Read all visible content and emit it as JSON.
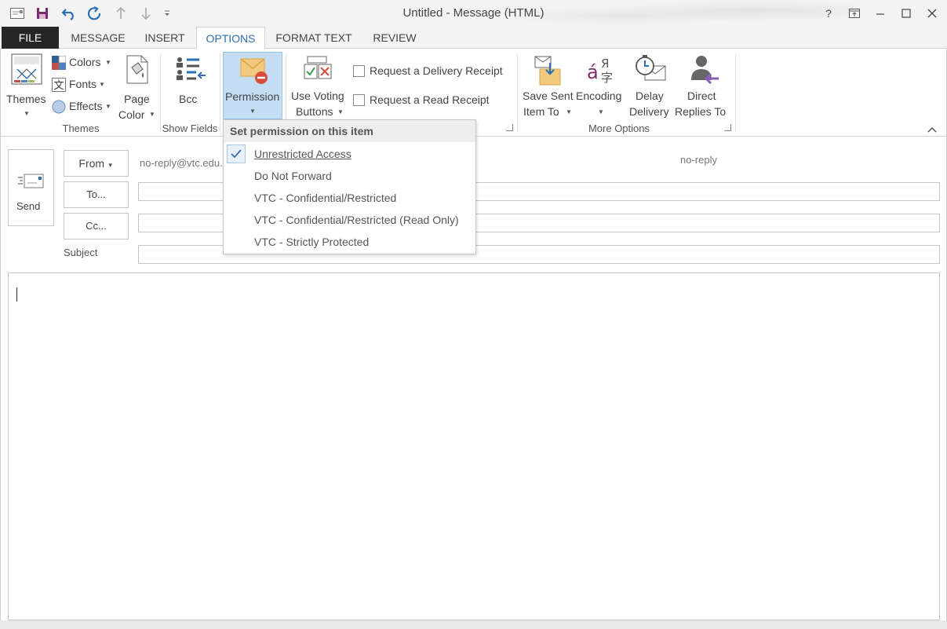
{
  "window": {
    "title": "Untitled - Message (HTML)",
    "help": "?"
  },
  "tabs": [
    "FILE",
    "MESSAGE",
    "INSERT",
    "OPTIONS",
    "FORMAT TEXT",
    "REVIEW"
  ],
  "ribbon": {
    "themes": {
      "themes_label": "Themes",
      "colors_label": "Colors",
      "fonts_label": "Fonts",
      "effects_label": "Effects",
      "page_label": "Page",
      "color_label": "Color",
      "group_label": "Themes"
    },
    "show_fields": {
      "bcc_label": "Bcc",
      "group_label": "Show Fields"
    },
    "permission": {
      "label": "Permission"
    },
    "tracking": {
      "voting_line1": "Use Voting",
      "voting_line2": "Buttons",
      "delivery_receipt": "Request a Delivery Receipt",
      "read_receipt": "Request a Read Receipt"
    },
    "more_options": {
      "save_line1": "Save Sent",
      "save_line2": "Item To",
      "encoding_label": "Encoding",
      "delay_line1": "Delay",
      "delay_line2": "Delivery",
      "direct_line1": "Direct",
      "direct_line2": "Replies To",
      "group_label": "More Options"
    }
  },
  "compose": {
    "send_label": "Send",
    "from_label": "From",
    "from_value": "no-reply@vtc.edu.",
    "from_name": "no-reply",
    "to_label": "To...",
    "cc_label": "Cc...",
    "subject_label": "Subject"
  },
  "permission_menu": {
    "title": "Set permission on this item",
    "items": [
      {
        "label": "Unrestricted Access",
        "checked": true
      },
      {
        "label": "Do Not Forward",
        "checked": false
      },
      {
        "label": "VTC - Confidential/Restricted",
        "checked": false
      },
      {
        "label": "VTC - Confidential/Restricted (Read Only)",
        "checked": false
      },
      {
        "label": "VTC - Strictly Protected",
        "checked": false
      }
    ]
  },
  "colors": {
    "accent": "#2a6fb5",
    "file_tab": "#262626",
    "highlight": "#c5ddf2"
  }
}
